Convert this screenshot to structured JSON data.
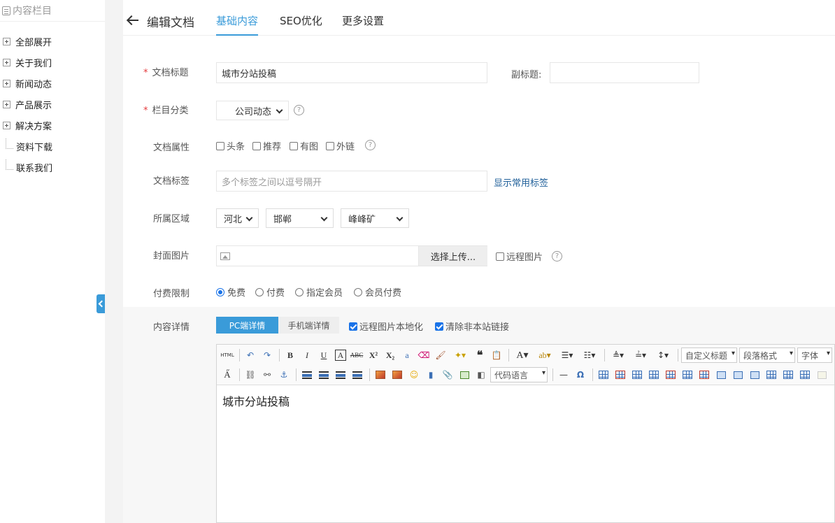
{
  "sidebar": {
    "title": "内容栏目",
    "items": [
      {
        "label": "全部展开",
        "expandable": true
      },
      {
        "label": "关于我们",
        "expandable": true
      },
      {
        "label": "新闻动态",
        "expandable": true
      },
      {
        "label": "产品展示",
        "expandable": true
      },
      {
        "label": "解决方案",
        "expandable": true
      },
      {
        "label": "资料下载",
        "expandable": false
      },
      {
        "label": "联系我们",
        "expandable": false
      }
    ]
  },
  "header": {
    "title": "编辑文档",
    "tabs": [
      {
        "label": "基础内容",
        "active": true
      },
      {
        "label": "SEO优化",
        "active": false
      },
      {
        "label": "更多设置",
        "active": false
      }
    ]
  },
  "form": {
    "title_label": "文档标题",
    "title_value": "城市分站投稿",
    "subtitle_label": "副标题:",
    "subtitle_value": "",
    "category_label": "栏目分类",
    "category_value": "公司动态",
    "attr_label": "文档属性",
    "attrs": [
      {
        "label": "头条",
        "checked": false
      },
      {
        "label": "推荐",
        "checked": false
      },
      {
        "label": "有图",
        "checked": false
      },
      {
        "label": "外链",
        "checked": false
      }
    ],
    "tags_label": "文档标签",
    "tags_placeholder": "多个标签之间以逗号隔开",
    "tags_link": "显示常用标签",
    "region_label": "所属区域",
    "region": {
      "province": "河北",
      "city": "邯郸",
      "district": "峰峰矿"
    },
    "cover_label": "封面图片",
    "cover_button": "选择上传...",
    "cover_remote": "远程图片",
    "pay_label": "付费限制",
    "pay_options": [
      {
        "label": "免费",
        "selected": true
      },
      {
        "label": "付费",
        "selected": false
      },
      {
        "label": "指定会员",
        "selected": false
      },
      {
        "label": "会员付费",
        "selected": false
      }
    ],
    "content_label": "内容详情",
    "content_tabs": [
      {
        "label": "PC端详情",
        "active": true
      },
      {
        "label": "手机端详情",
        "active": false
      }
    ],
    "localize_images": {
      "label": "远程图片本地化",
      "checked": true
    },
    "strip_links": {
      "label": "清除非本站链接",
      "checked": true
    }
  },
  "editor": {
    "combos": {
      "code_lang": "代码语言",
      "custom_heading": "自定义标题",
      "paragraph": "段落格式",
      "font": "字体"
    },
    "html_label": "HTML",
    "content": "城市分站投稿"
  },
  "colors": {
    "accent": "#3a9bd9",
    "required": "#e4393c",
    "link": "#1f5f99",
    "checkbox": "#1a73e8"
  }
}
